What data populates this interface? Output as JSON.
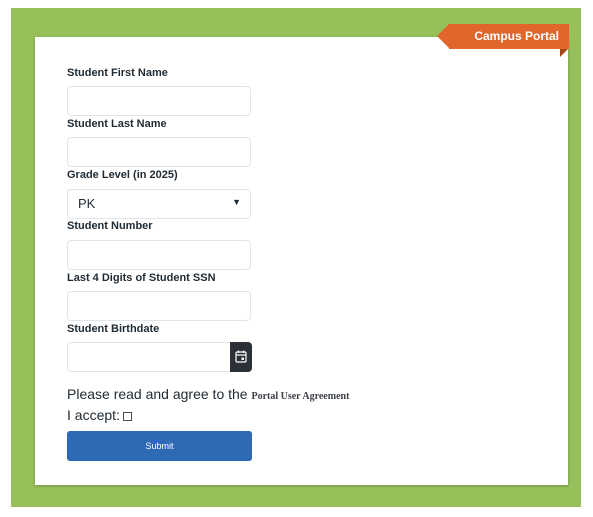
{
  "portal": {
    "badge": "Campus Portal"
  },
  "form": {
    "first_name": {
      "label": "Student First Name",
      "value": ""
    },
    "last_name": {
      "label": "Student Last Name",
      "value": ""
    },
    "grade": {
      "label": "Grade Level (in 2025)",
      "selected": "PK"
    },
    "student_number": {
      "label": "Student Number",
      "value": ""
    },
    "ssn": {
      "label": "Last 4 Digits of Student SSN",
      "value": ""
    },
    "birthdate": {
      "label": "Student Birthdate",
      "value": ""
    },
    "agreement_text": "Please read and agree to the ",
    "agreement_link": "Portal User Agreement",
    "accept_label": "I accept:",
    "accept_checked": false,
    "submit_label": "Submit"
  },
  "colors": {
    "background": "#97c05a",
    "ribbon": "#e0662b",
    "submit": "#2d6ab3",
    "calendar_button": "#2b3037"
  },
  "icons": {
    "calendar": "calendar-icon",
    "dropdown": "chevron-down-icon"
  }
}
